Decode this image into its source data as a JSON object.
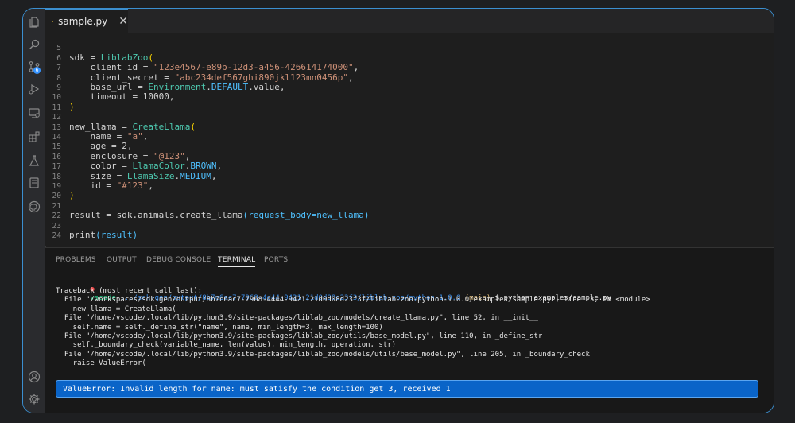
{
  "tab": {
    "filename": "sample.py",
    "close": "✕"
  },
  "activity_bar": {
    "source_control_badge": "6"
  },
  "editor": {
    "lines": [
      {
        "n": "5",
        "parts": []
      },
      {
        "n": "6",
        "parts": [
          {
            "t": "sdk = ",
            "c": ""
          },
          {
            "t": "LiblabZoo",
            "c": "k-cls"
          },
          {
            "t": "(",
            "c": "k-pn"
          }
        ]
      },
      {
        "n": "7",
        "parts": [
          {
            "t": "    client_id = ",
            "c": ""
          },
          {
            "t": "\"123e4567-e89b-12d3-a456-426614174000\"",
            "c": "k-str"
          },
          {
            "t": ",",
            "c": ""
          }
        ]
      },
      {
        "n": "8",
        "parts": [
          {
            "t": "    client_secret = ",
            "c": ""
          },
          {
            "t": "\"abc234def567ghi890jkl123mn0456p\"",
            "c": "k-str"
          },
          {
            "t": ",",
            "c": ""
          }
        ]
      },
      {
        "n": "9",
        "parts": [
          {
            "t": "    base_url = ",
            "c": ""
          },
          {
            "t": "Environment",
            "c": "k-cls"
          },
          {
            "t": ".",
            "c": ""
          },
          {
            "t": "DEFAULT",
            "c": "k-lit"
          },
          {
            "t": ".value,",
            "c": ""
          }
        ]
      },
      {
        "n": "10",
        "parts": [
          {
            "t": "    timeout = ",
            "c": ""
          },
          {
            "t": "10000",
            "c": ""
          },
          {
            "t": ",",
            "c": ""
          }
        ]
      },
      {
        "n": "11",
        "parts": [
          {
            "t": ")",
            "c": "k-pn"
          }
        ]
      },
      {
        "n": "12",
        "parts": []
      },
      {
        "n": "13",
        "parts": [
          {
            "t": "new_llama = ",
            "c": ""
          },
          {
            "t": "CreateLlama",
            "c": "k-cls"
          },
          {
            "t": "(",
            "c": "k-pn"
          }
        ]
      },
      {
        "n": "14",
        "parts": [
          {
            "t": "    name = ",
            "c": ""
          },
          {
            "t": "\"a\"",
            "c": "k-str"
          },
          {
            "t": ",",
            "c": ""
          }
        ]
      },
      {
        "n": "15",
        "parts": [
          {
            "t": "    age = 2,",
            "c": ""
          }
        ]
      },
      {
        "n": "16",
        "parts": [
          {
            "t": "    enclosure = ",
            "c": ""
          },
          {
            "t": "\"@123\"",
            "c": "k-str"
          },
          {
            "t": ",",
            "c": ""
          }
        ]
      },
      {
        "n": "17",
        "parts": [
          {
            "t": "    color = ",
            "c": ""
          },
          {
            "t": "LlamaColor",
            "c": "k-cls"
          },
          {
            "t": ".",
            "c": ""
          },
          {
            "t": "BROWN",
            "c": "k-lit"
          },
          {
            "t": ",",
            "c": ""
          }
        ]
      },
      {
        "n": "18",
        "parts": [
          {
            "t": "    size = ",
            "c": ""
          },
          {
            "t": "LlamaSize",
            "c": "k-cls"
          },
          {
            "t": ".",
            "c": ""
          },
          {
            "t": "MEDIUM",
            "c": "k-lit"
          },
          {
            "t": ",",
            "c": ""
          }
        ]
      },
      {
        "n": "19",
        "parts": [
          {
            "t": "    id = ",
            "c": ""
          },
          {
            "t": "\"#123\"",
            "c": "k-str"
          },
          {
            "t": ",",
            "c": ""
          }
        ]
      },
      {
        "n": "20",
        "parts": [
          {
            "t": ")",
            "c": "k-pn"
          }
        ]
      },
      {
        "n": "21",
        "parts": []
      },
      {
        "n": "22",
        "parts": [
          {
            "t": "result = sdk.animals.create_llama",
            "c": ""
          },
          {
            "t": "(",
            "c": "k-arg"
          },
          {
            "t": "request_body=new_llama",
            "c": "k-arg"
          },
          {
            "t": ")",
            "c": "k-arg"
          }
        ]
      },
      {
        "n": "23",
        "parts": []
      },
      {
        "n": "24",
        "parts": [
          {
            "t": "print",
            "c": ""
          },
          {
            "t": "(",
            "c": "k-arg"
          },
          {
            "t": "result",
            "c": "k-arg"
          },
          {
            "t": ")",
            "c": "k-arg"
          }
        ]
      }
    ]
  },
  "panel": {
    "tabs": [
      "PROBLEMS",
      "OUTPUT",
      "DEBUG CONSOLE",
      "TERMINAL",
      "PORTS"
    ],
    "active_tab": "TERMINAL",
    "prompt": {
      "dot": "●",
      "user": "vscode",
      "path": " .../sdk-gen/output/8b7c6ac7-7968-4d44-9421-21d0d08d23f3/liblab-zoo/python-1.0.0",
      "branch": " (main)",
      "command": " $ python examples/sample.py"
    },
    "output": [
      "Traceback (most recent call last):",
      "  File \"/workspaces/sdk-gen/output/8b7c6ac7-7968-4444-9421-21d0d08d23f3f/liblab-zoo-python-1.0.0/examples/sample.py\", line 13, in <module>",
      "    new_llama = CreateLlama(",
      "  File \"/home/vscode/.local/lib/python3.9/site-packages/liblab_zoo/models/create_llama.py\", line 52, in __init__",
      "    self.name = self._define_str(\"name\", name, min_length=3, max_length=100)",
      "  File \"/home/vscode/.local/lib/python3.9/site-packages/liblab_zoo/utils/base_model.py\", line 110, in _define_str",
      "    self._boundary_check(variable_name, len(value), min_length, operation, str)",
      "  File \"/home/vscode/.local/lib/python3.9/site-packages/liblab_zoo/models/utils/base_model.py\", line 205, in _boundary_check",
      "    raise ValueError("
    ],
    "error": "ValueError: Invalid length for name: must satisfy the condition get 3, received 1"
  }
}
